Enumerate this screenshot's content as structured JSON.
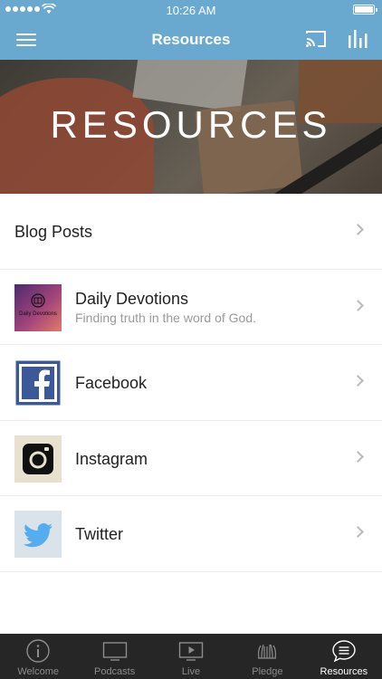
{
  "status_bar": {
    "time": "10:26 AM"
  },
  "nav": {
    "title": "Resources",
    "icons": [
      "menu-icon",
      "cast-icon",
      "bar-chart-icon"
    ]
  },
  "hero": {
    "title": "RESOURCES"
  },
  "list": {
    "items": [
      {
        "label": "Blog Posts"
      },
      {
        "label": "Daily Devotions",
        "subtitle": "Finding truth in the word of God.",
        "thumb_text": "Daily Devotions"
      },
      {
        "label": "Facebook"
      },
      {
        "label": "Instagram"
      },
      {
        "label": "Twitter"
      }
    ]
  },
  "tabs": [
    {
      "label": "Welcome",
      "icon": "info-icon"
    },
    {
      "label": "Podcasts",
      "icon": "tv-icon"
    },
    {
      "label": "Live",
      "icon": "play-screen-icon"
    },
    {
      "label": "Pledge",
      "icon": "hands-icon"
    },
    {
      "label": "Resources",
      "icon": "chat-list-icon",
      "active": true
    }
  ],
  "colors": {
    "nav_bg": "#6aa9cf",
    "tab_bg": "#262626",
    "facebook": "#3b5998",
    "twitter": "#55acee"
  }
}
